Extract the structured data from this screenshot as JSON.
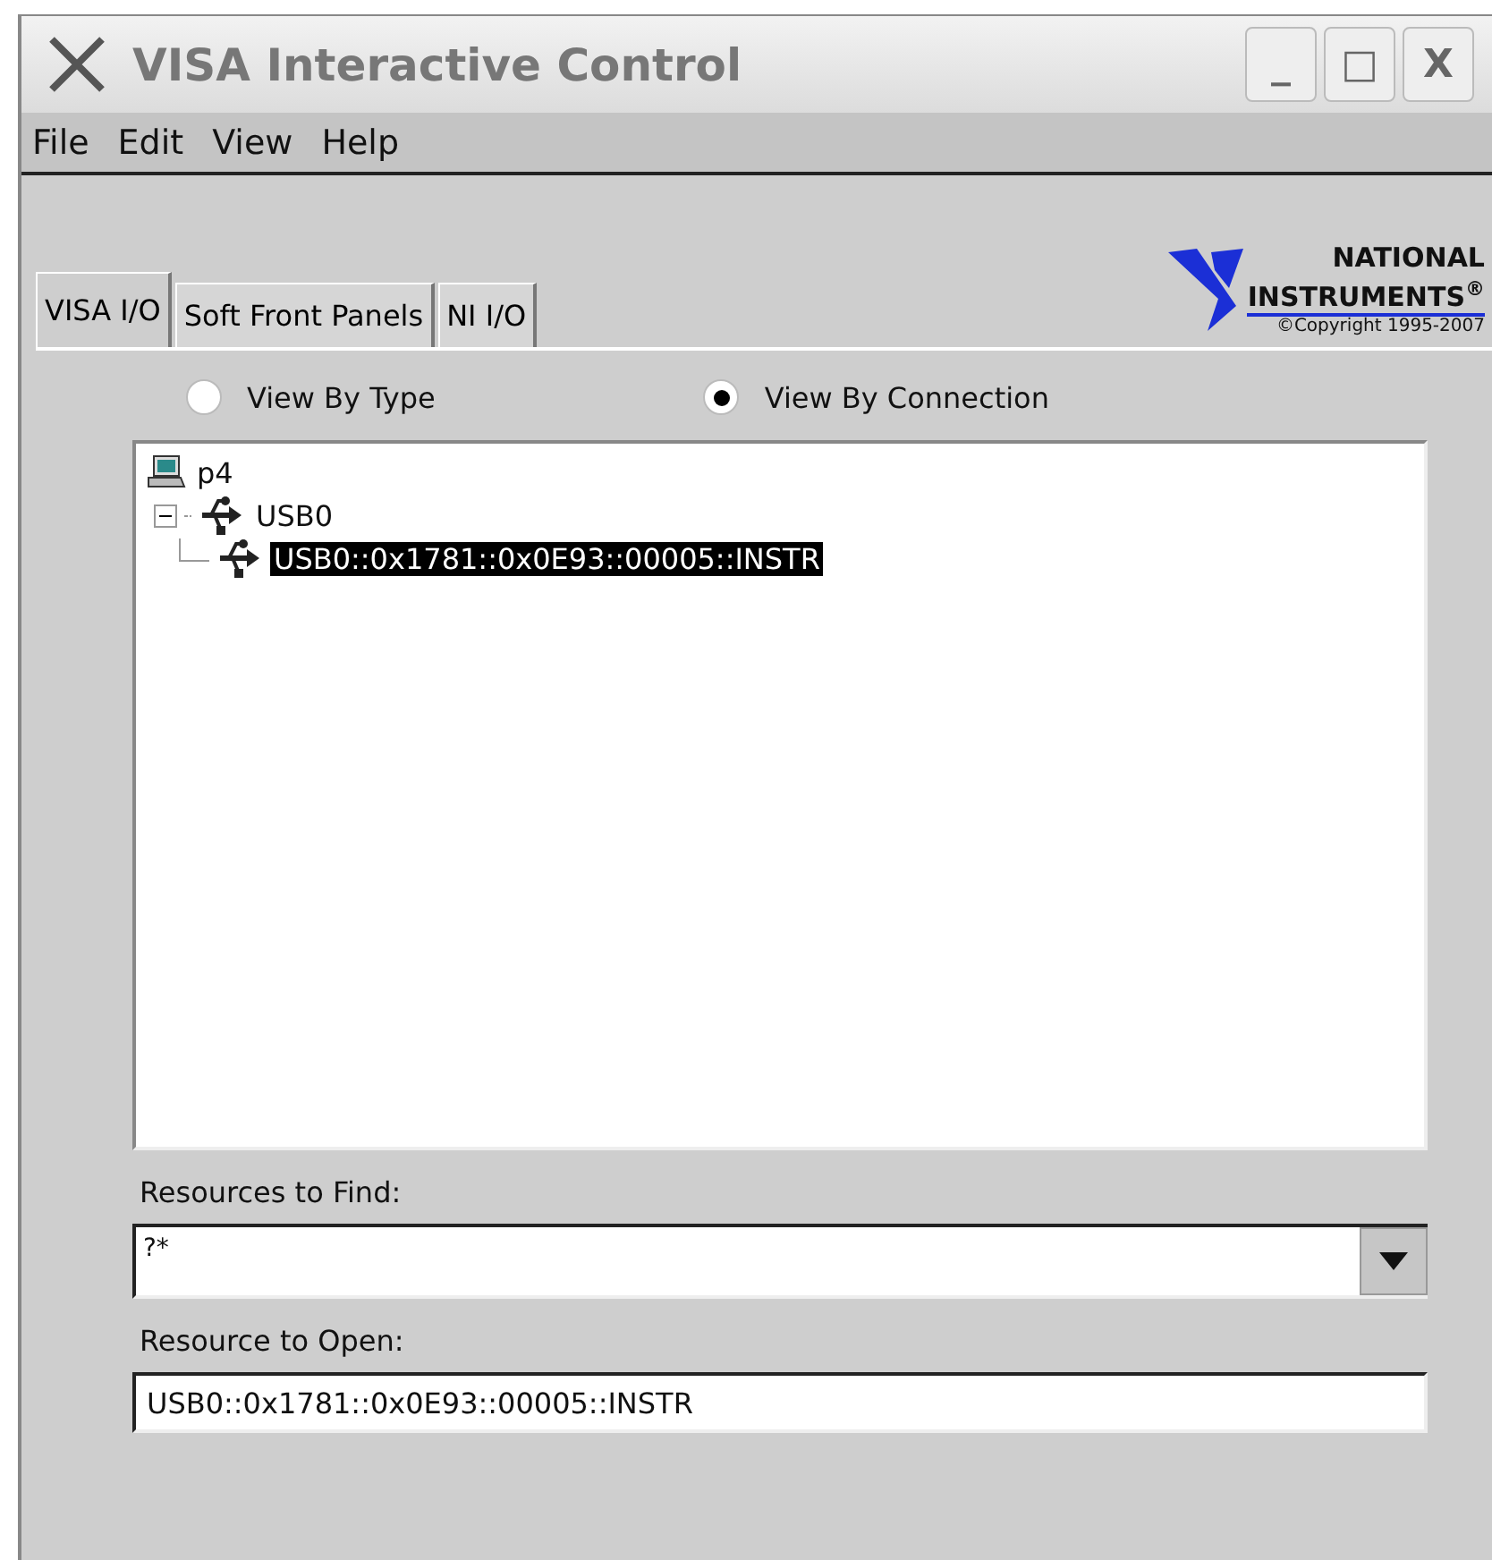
{
  "window": {
    "title": "VISA Interactive Control",
    "controls": [
      "_",
      "□",
      "X"
    ]
  },
  "menu": [
    "File",
    "Edit",
    "View",
    "Help"
  ],
  "logo": {
    "line1": "NATIONAL",
    "line2": "INSTRUMENTS",
    "mark": "®",
    "copyright": "©Copyright 1995-2007"
  },
  "tabs": [
    {
      "label": "VISA I/O",
      "selected": true
    },
    {
      "label": "Soft Front Panels",
      "selected": false
    },
    {
      "label": "NI I/O",
      "selected": false
    }
  ],
  "view_options": [
    {
      "label": "View By Type",
      "selected": false
    },
    {
      "label": "View By Connection",
      "selected": true
    }
  ],
  "tree": [
    {
      "label": "p4",
      "kind": "computer",
      "selected": false,
      "children": [
        {
          "label": "USB0",
          "kind": "usb",
          "selected": false,
          "expanded": true,
          "children": [
            {
              "label": "USB0::0x1781::0x0E93::00005::INSTR",
              "kind": "usb",
              "selected": true
            }
          ]
        }
      ]
    }
  ],
  "resources_to_find": {
    "label": "Resources to Find:",
    "value": "?*"
  },
  "resource_to_open": {
    "label": "Resource to Open:",
    "value": "USB0::0x1781::0x0E93::00005::INSTR"
  }
}
